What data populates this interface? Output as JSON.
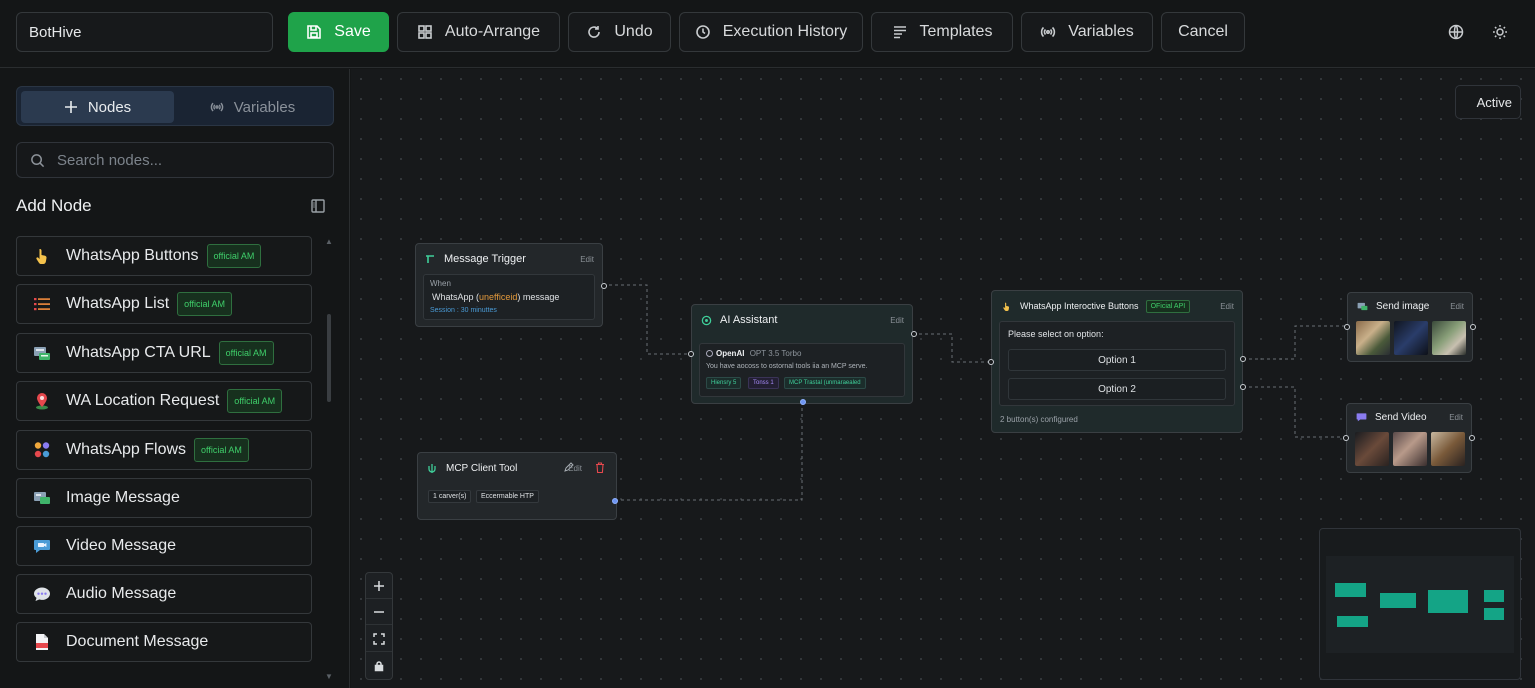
{
  "toolbar": {
    "bot_name": "BotHive",
    "save": "Save",
    "auto_arrange": "Auto-Arrange",
    "undo": "Undo",
    "execution_history": "Execution History",
    "templates": "Templates",
    "variables": "Variables",
    "cancel": "Cancel"
  },
  "sidebar": {
    "tabs": [
      {
        "label": "Nodes",
        "active": true
      },
      {
        "label": "Variables",
        "active": false
      }
    ],
    "search_placeholder": "Search nodes...",
    "add_node_title": "Add Node",
    "items": [
      {
        "label": "WhatsApp Buttons",
        "badge": "official AM",
        "icon": "pointing-hand-icon"
      },
      {
        "label": "WhatsApp List",
        "badge": "official AM",
        "icon": "list-icon"
      },
      {
        "label": "WhatsApp CTA URL",
        "badge": "official AM",
        "icon": "link-card-icon"
      },
      {
        "label": "WA Location Request",
        "badge": "official AM",
        "icon": "location-pin-icon"
      },
      {
        "label": "WhatsApp Flows",
        "badge": "official AM",
        "icon": "flows-icon"
      },
      {
        "label": "Image Message",
        "badge": "",
        "icon": "image-icon"
      },
      {
        "label": "Video Message",
        "badge": "",
        "icon": "video-icon"
      },
      {
        "label": "Audio Message",
        "badge": "",
        "icon": "audio-icon"
      },
      {
        "label": "Document Message",
        "badge": "",
        "icon": "document-icon"
      }
    ]
  },
  "canvas": {
    "status": "Active",
    "nodes": {
      "trigger": {
        "title": "Message Trigger",
        "edit": "Edit",
        "when": "When",
        "condition_pre": "WhatsApp (",
        "condition_highlight": "unefficeid",
        "condition_post": ") message",
        "session": "Session : 30 minuttes"
      },
      "ai": {
        "title": "AI Assistant",
        "edit": "Edit",
        "provider": "OpenAI",
        "model": "OPT 3.5 Torbo",
        "description": "You have aocoss to ostornal tools iia an MCP serve.",
        "chips": [
          "Hiensry 5",
          "Tonss 1",
          "MCP Trastal (unmaraealed"
        ]
      },
      "mcp": {
        "title": "MCP Client Tool",
        "edit": "Edit",
        "chips": [
          "1 carver(s)",
          "Eccermable HTP"
        ]
      },
      "buttons": {
        "title": "WhatsApp Interoctive Buttons",
        "badge": "OFicial API",
        "edit": "Edit",
        "prompt": "Please select on option:",
        "options": [
          "Option 1",
          "Option 2"
        ],
        "footer": "2 button(s) configured"
      },
      "send_image": {
        "title": "Send image",
        "edit": "Edit"
      },
      "send_video": {
        "title": "Send Video",
        "edit": "Edit"
      }
    }
  },
  "colors": {
    "accent_green": "#1fa34a",
    "badge_green": "#3fcf6a",
    "minimap_node": "#14a486",
    "highlight_orange": "#e49a3c",
    "link_blue": "#4a9bd6"
  }
}
